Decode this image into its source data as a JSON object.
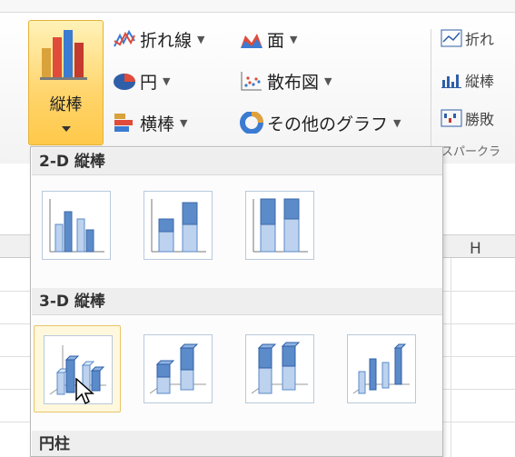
{
  "ribbon": {
    "column_button": {
      "label": "縦棒"
    },
    "items": [
      {
        "id": "line",
        "label": "折れ線"
      },
      {
        "id": "area",
        "label": "面"
      },
      {
        "id": "pie",
        "label": "円"
      },
      {
        "id": "scatter",
        "label": "散布図"
      },
      {
        "id": "bar",
        "label": "横棒"
      },
      {
        "id": "other",
        "label": "その他のグラフ"
      }
    ],
    "sparklines": {
      "line": "折れ",
      "column": "縦棒",
      "winloss": "勝敗",
      "group_label": "スパークラ"
    }
  },
  "sheet": {
    "column_header": "H"
  },
  "gallery": {
    "sections": [
      {
        "title": "2-D 縦棒"
      },
      {
        "title": "3-D 縦棒"
      },
      {
        "title": "円柱"
      }
    ]
  },
  "colors": {
    "accent": "#ffd46a",
    "selected_border": "#e9c46a",
    "chart_blue": "#5b8bc9"
  }
}
